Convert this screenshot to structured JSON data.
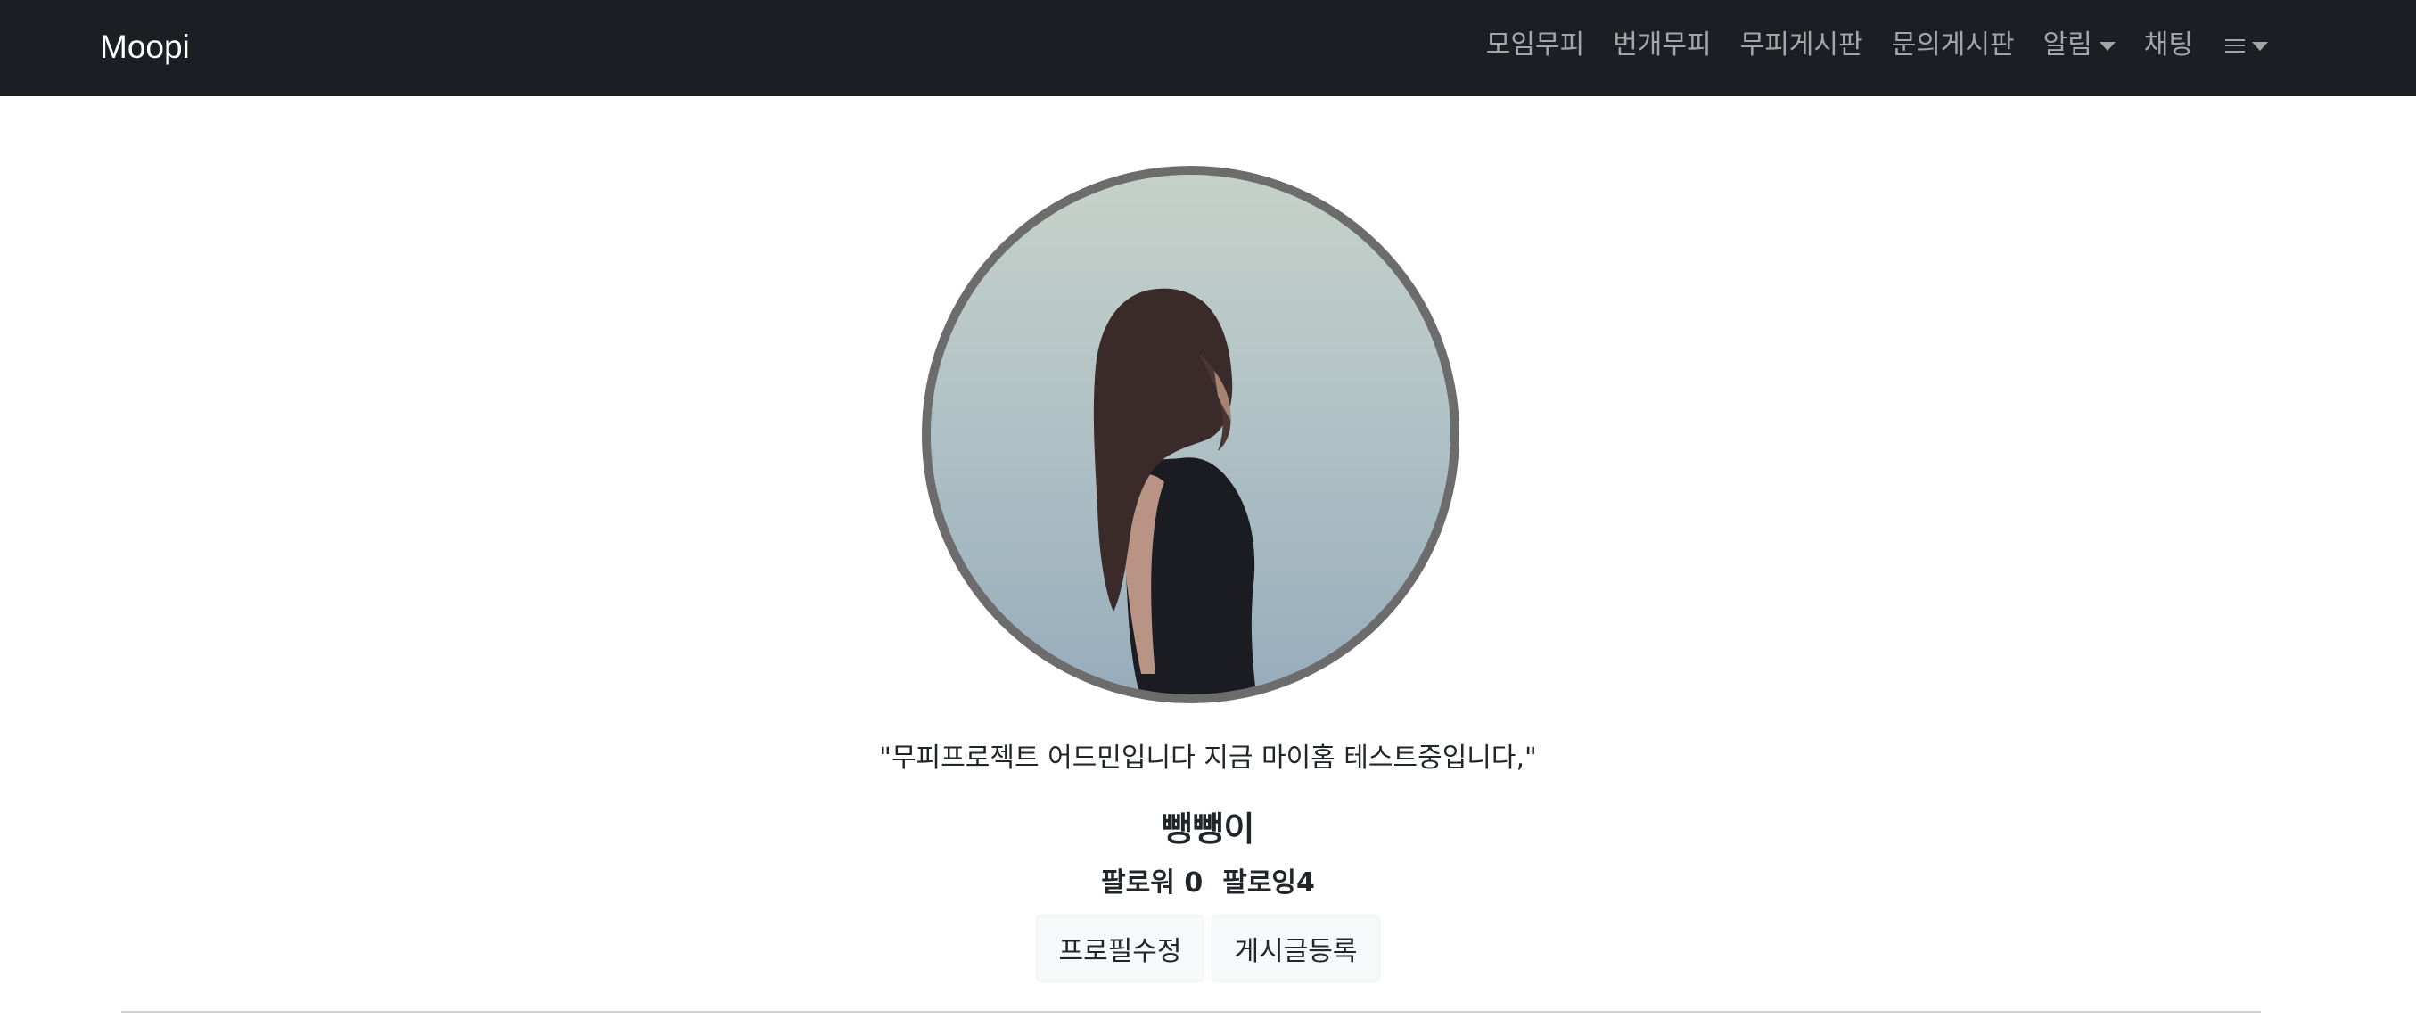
{
  "navbar": {
    "brand": "Moopi",
    "items": [
      {
        "label": "모임무피",
        "has_caret": false
      },
      {
        "label": "번개무피",
        "has_caret": false
      },
      {
        "label": "무피게시판",
        "has_caret": false
      },
      {
        "label": "문의게시판",
        "has_caret": false
      },
      {
        "label": "알림",
        "has_caret": true
      },
      {
        "label": "채팅",
        "has_caret": false
      }
    ],
    "menu_icon": "hamburger-icon",
    "menu_has_caret": true
  },
  "profile": {
    "avatar_icon": "profile-photo",
    "bio": "\"무피프로젝트 어드민입니다 지금 마이홈 테스트중입니다,\"",
    "nickname": "뺑뺑이",
    "followers_label": "팔로워",
    "followers_count": "0",
    "following_label": "팔로잉",
    "following_count": "4"
  },
  "actions": {
    "edit_profile": "프로필수정",
    "new_post": "게시글등록"
  },
  "colors": {
    "navbar_bg": "#1b1f23",
    "avatar_border": "#6c6c6c",
    "button_bg": "#f7f8f9"
  }
}
